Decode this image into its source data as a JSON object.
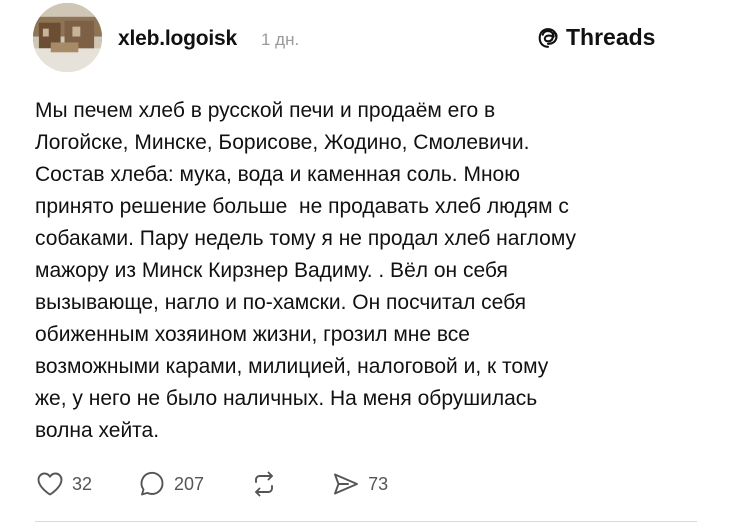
{
  "post": {
    "author": "xleb.logoisk",
    "time": "1 дн.",
    "platform": "Threads",
    "body_lines": [
      "Мы печем хлеб в русской печи и продаём его в",
      "Логойске, Минске, Борисове, Жодино, Смолевичи.",
      "Состав хлеба: мука, вода и каменная соль. Мною",
      "принято решение больше  не продавать хлеб людям с",
      "собаками. Пару недель тому я не продал хлеб наглому",
      "мажору из Минск Кирзнер Вадиму. . Вёл он себя",
      "вызывающе, нагло и по-хамски. Он посчитал себя",
      "обиженным хозяином жизни, грозил мне все",
      "возможными карами, милицией, налоговой и, к тому",
      "же, у него не было наличных. На меня обрушилась",
      "волна хейта."
    ]
  },
  "actions": {
    "likes": "32",
    "comments": "207",
    "reposts": "",
    "shares": "73"
  },
  "icons": {
    "like": "heart-icon",
    "comment": "comment-icon",
    "repost": "repost-icon",
    "share": "share-icon",
    "brand": "threads-logo-icon"
  }
}
